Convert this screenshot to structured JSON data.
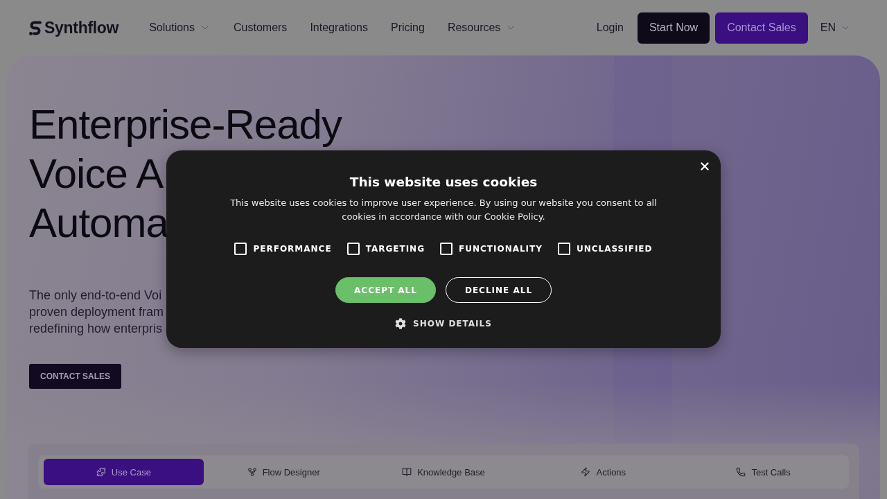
{
  "nav": {
    "logo": "Synthflow",
    "links": [
      {
        "label": "Solutions",
        "dropdown": true
      },
      {
        "label": "Customers",
        "dropdown": false
      },
      {
        "label": "Integrations",
        "dropdown": false
      },
      {
        "label": "Pricing",
        "dropdown": false
      },
      {
        "label": "Resources",
        "dropdown": true
      }
    ],
    "login": "Login",
    "buttons": [
      {
        "label": "Start Now",
        "kind": "dark"
      },
      {
        "label": "Contact Sales",
        "kind": "purple"
      }
    ],
    "language": "EN"
  },
  "hero": {
    "heading_lines": [
      "Enterprise-Ready",
      "Voice A",
      "Automa"
    ],
    "description_lines": [
      "The only end-to-end Voi",
      "proven deployment fram",
      "redefining how enterpris"
    ],
    "cta": "CONTACT SALES"
  },
  "feature_tabs": [
    {
      "label": "Use Case",
      "selected": true
    },
    {
      "label": "Flow Designer",
      "selected": false
    },
    {
      "label": "Knowledge Base",
      "selected": false
    },
    {
      "label": "Actions",
      "selected": false
    },
    {
      "label": "Test Calls",
      "selected": false
    }
  ],
  "cookie_dialog": {
    "title": "This website uses cookies",
    "text": "This website uses cookies to improve user experience. By using our website you consent to all cookies in accordance with our Cookie Policy.",
    "categories": [
      {
        "label": "PERFORMANCE",
        "checked": false
      },
      {
        "label": "TARGETING",
        "checked": false
      },
      {
        "label": "FUNCTIONALITY",
        "checked": false
      },
      {
        "label": "UNCLASSIFIED",
        "checked": false
      }
    ],
    "buttons": [
      {
        "label": "ACCEPT ALL",
        "kind": "accept"
      },
      {
        "label": "DECLINE ALL",
        "kind": "decline"
      }
    ],
    "details_link": "SHOW DETAILS"
  }
}
